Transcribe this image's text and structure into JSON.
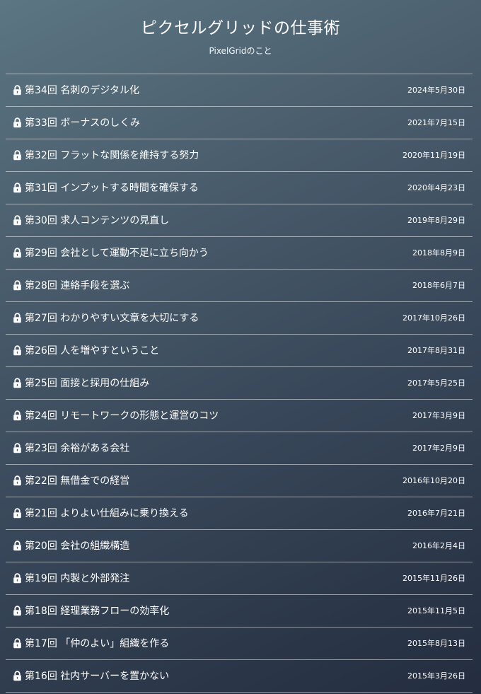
{
  "header": {
    "title": "ピクセルグリッドの仕事術",
    "subtitle": "PixelGridのこと"
  },
  "icons": {
    "row_icon": "lock-icon"
  },
  "colors": {
    "text": "#ffffff",
    "divider": "rgba(255,255,255,0.5)",
    "background_top": "#5c7683",
    "background_bottom": "#232d3f"
  },
  "articles": [
    {
      "title": "第34回 名刺のデジタル化",
      "date": "2024年5月30日"
    },
    {
      "title": "第33回 ボーナスのしくみ",
      "date": "2021年7月15日"
    },
    {
      "title": "第32回 フラットな関係を維持する努力",
      "date": "2020年11月19日"
    },
    {
      "title": "第31回 インプットする時間を確保する",
      "date": "2020年4月23日"
    },
    {
      "title": "第30回 求人コンテンツの見直し",
      "date": "2019年8月29日"
    },
    {
      "title": "第29回 会社として運動不足に立ち向かう",
      "date": "2018年8月9日"
    },
    {
      "title": "第28回 連絡手段を選ぶ",
      "date": "2018年6月7日"
    },
    {
      "title": "第27回 わかりやすい文章を大切にする",
      "date": "2017年10月26日"
    },
    {
      "title": "第26回 人を増やすということ",
      "date": "2017年8月31日"
    },
    {
      "title": "第25回 面接と採用の仕組み",
      "date": "2017年5月25日"
    },
    {
      "title": "第24回 リモートワークの形態と運営のコツ",
      "date": "2017年3月9日"
    },
    {
      "title": "第23回 余裕がある会社",
      "date": "2017年2月9日"
    },
    {
      "title": "第22回 無借金での経営",
      "date": "2016年10月20日"
    },
    {
      "title": "第21回 よりよい仕組みに乗り換える",
      "date": "2016年7月21日"
    },
    {
      "title": "第20回 会社の組織構造",
      "date": "2016年2月4日"
    },
    {
      "title": "第19回 内製と外部発注",
      "date": "2015年11月26日"
    },
    {
      "title": "第18回 経理業務フローの効率化",
      "date": "2015年11月5日"
    },
    {
      "title": "第17回 「仲のよい」組織を作る",
      "date": "2015年8月13日"
    },
    {
      "title": "第16回 社内サーバーを置かない",
      "date": "2015年3月26日"
    }
  ]
}
